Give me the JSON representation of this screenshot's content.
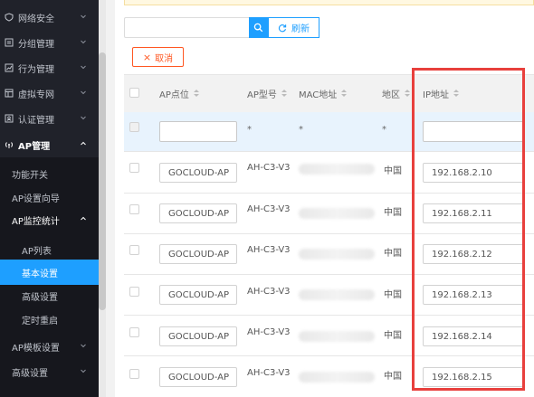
{
  "sidebar": {
    "items": [
      {
        "label": "网络安全",
        "icon": "shield-icon"
      },
      {
        "label": "分组管理",
        "icon": "list-icon"
      },
      {
        "label": "行为管理",
        "icon": "chart-icon"
      },
      {
        "label": "虚拟专网",
        "icon": "window-icon"
      },
      {
        "label": "认证管理",
        "icon": "id-card-icon"
      },
      {
        "label": "AP管理",
        "icon": "wifi-icon"
      }
    ],
    "ap_sub": [
      {
        "label": "功能开关"
      },
      {
        "label": "AP设置向导"
      },
      {
        "label": "AP监控统计"
      }
    ],
    "monitor_sub": [
      {
        "label": "AP列表"
      },
      {
        "label": "基本设置"
      },
      {
        "label": "高级设置"
      },
      {
        "label": "定时重启"
      }
    ],
    "more": [
      {
        "label": "AP模板设置"
      },
      {
        "label": "高级设置"
      }
    ]
  },
  "toolbar": {
    "search_placeholder": "",
    "refresh_label": "刷新",
    "cancel_label": "取消",
    "cancel_icon": "×"
  },
  "table": {
    "headers": [
      "AP点位",
      "AP型号",
      "MAC地址",
      "地区",
      "IP地址"
    ],
    "filter_star": "*",
    "rows": [
      {
        "name": "GOCLOUD-AP",
        "model": "AH-C3-V3",
        "region": "中国",
        "ip": "192.168.2.10"
      },
      {
        "name": "GOCLOUD-AP",
        "model": "AH-C3-V3",
        "region": "中国",
        "ip": "192.168.2.11"
      },
      {
        "name": "GOCLOUD-AP",
        "model": "AH-C3-V3",
        "region": "中国",
        "ip": "192.168.2.12"
      },
      {
        "name": "GOCLOUD-AP",
        "model": "AH-C3-V3",
        "region": "中国",
        "ip": "192.168.2.13"
      },
      {
        "name": "GOCLOUD-AP",
        "model": "AH-C3-V3",
        "region": "中国",
        "ip": "192.168.2.14"
      },
      {
        "name": "GOCLOUD-AP",
        "model": "AH-C3-V3",
        "region": "中国",
        "ip": "192.168.2.15"
      }
    ]
  },
  "colors": {
    "accent": "#1e9fff",
    "danger": "#ff5722",
    "highlight_box": "#e8403d",
    "sidebar_bg": "#20222a"
  }
}
